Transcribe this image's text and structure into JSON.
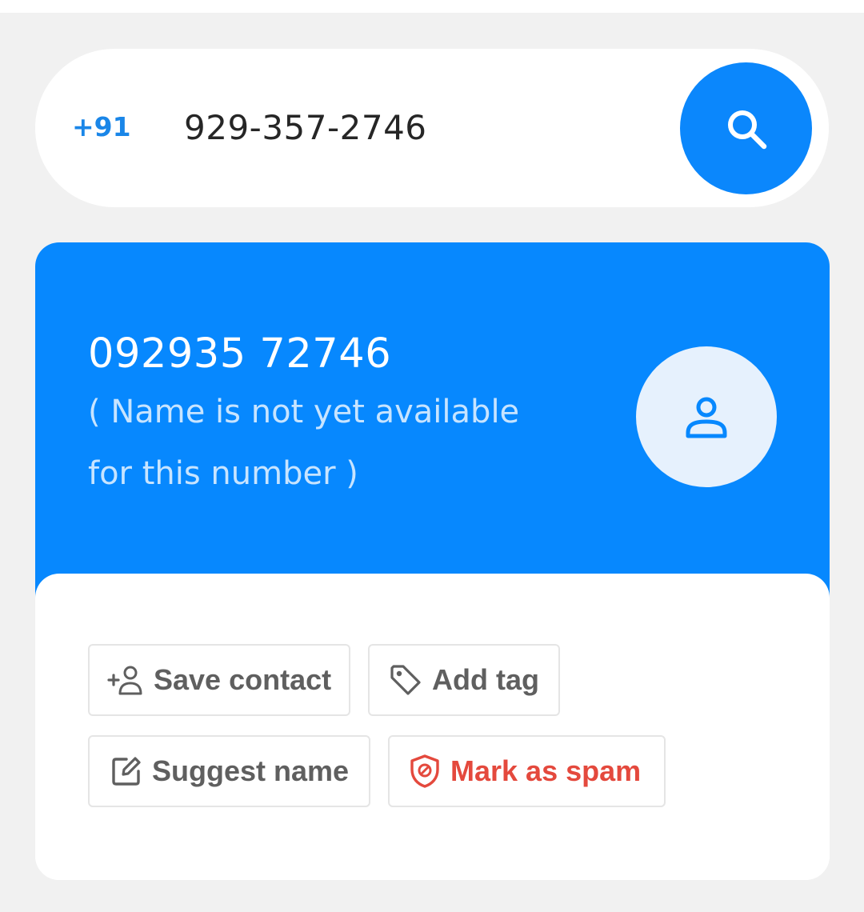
{
  "search": {
    "country_code": "+91",
    "phone_value": "929-357-2746"
  },
  "result": {
    "number": "092935 72746",
    "note_line1": "( Name is not yet available",
    "note_line2": "for this number )"
  },
  "actions": {
    "save_contact": "Save contact",
    "add_tag": "Add tag",
    "suggest_name": "Suggest name",
    "mark_as_spam": "Mark as spam"
  },
  "icons": {
    "search": "search-icon",
    "avatar": "person-icon",
    "save_contact": "add-person-icon",
    "add_tag": "tag-icon",
    "suggest_name": "edit-icon",
    "mark_as_spam": "shield-icon"
  },
  "colors": {
    "accent": "#0788fe",
    "country_code": "#1a86e8",
    "spam": "#e4493d",
    "button_text": "#5f5f5f",
    "note_text": "#c7e4ff"
  }
}
